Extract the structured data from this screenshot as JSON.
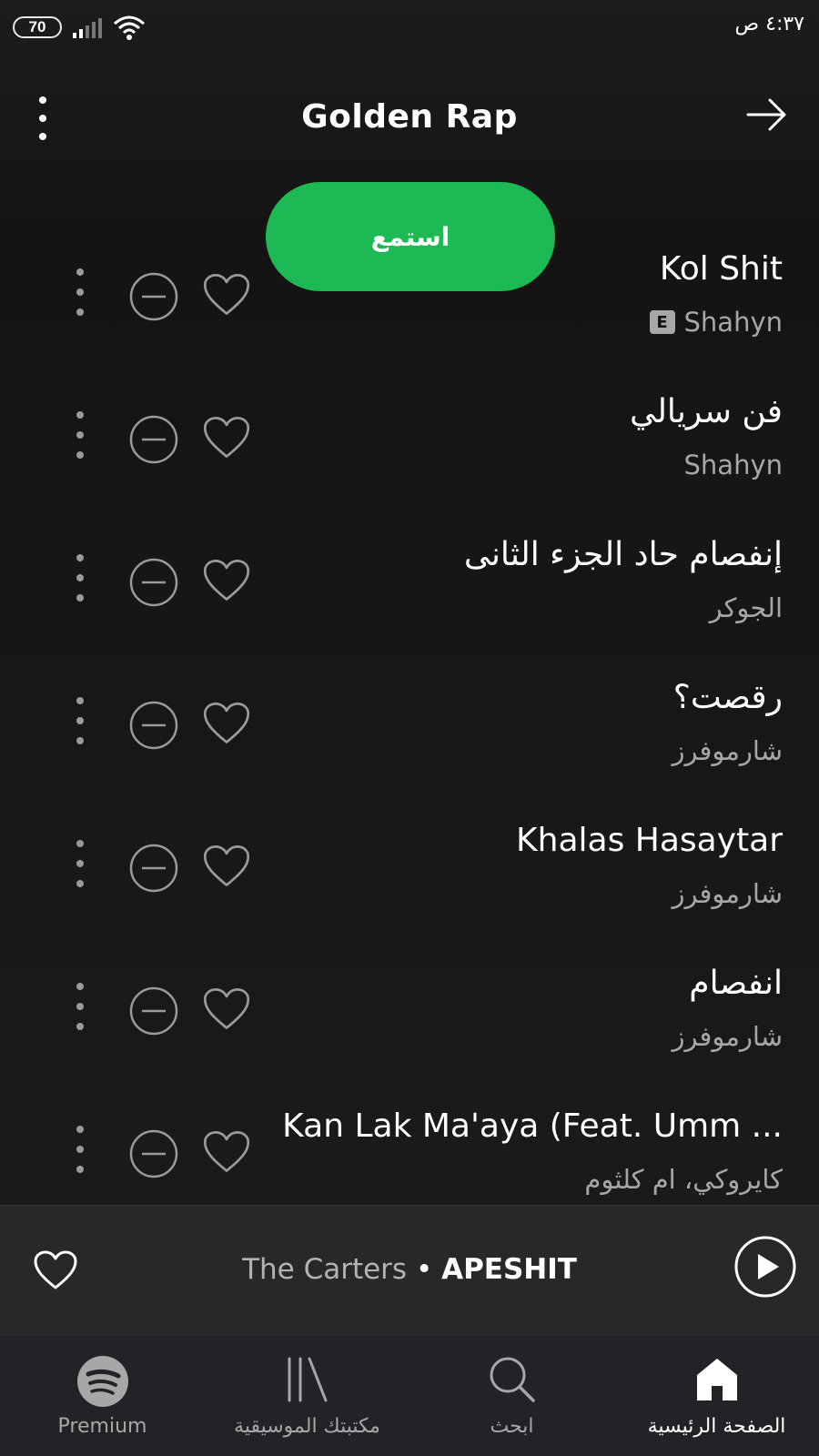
{
  "status_bar": {
    "battery": "70",
    "time": "٤:٣٧ ص"
  },
  "header": {
    "title": "Golden Rap"
  },
  "play_button": {
    "label": "استمع"
  },
  "tracks": [
    {
      "title": "Kol Shit",
      "artist": "Shahyn",
      "explicit": true,
      "explicit_label": "E"
    },
    {
      "title": "فن سريالي",
      "artist": "Shahyn",
      "explicit": false
    },
    {
      "title": "إنفصام حاد الجزء الثانى",
      "artist": "الجوكر",
      "explicit": false
    },
    {
      "title": "رقصت؟",
      "artist": "شارموفرز",
      "explicit": false
    },
    {
      "title": "Khalas Hasaytar",
      "artist": "شارموفرز",
      "explicit": false
    },
    {
      "title": "انفصام",
      "artist": "شارموفرز",
      "explicit": false
    },
    {
      "title": "Kan Lak Ma'aya (Feat. Umm ...",
      "artist": "كايروكي، ام كلثوم",
      "explicit": false
    }
  ],
  "now_playing": {
    "artist": "The Carters",
    "separator": " • ",
    "song": "APESHIT"
  },
  "bottom_nav": [
    {
      "label": "Premium",
      "icon": "spotify-logo-icon",
      "active": false
    },
    {
      "label": "مكتبتك الموسيقية",
      "icon": "library-icon",
      "active": false
    },
    {
      "label": "ابحث",
      "icon": "search-icon",
      "active": false
    },
    {
      "label": "الصفحة الرئيسية",
      "icon": "home-icon",
      "active": true
    }
  ],
  "colors": {
    "accent": "#1db954",
    "background": "#121212",
    "secondary_text": "#a7a7a7",
    "player_bar": "#282828"
  }
}
